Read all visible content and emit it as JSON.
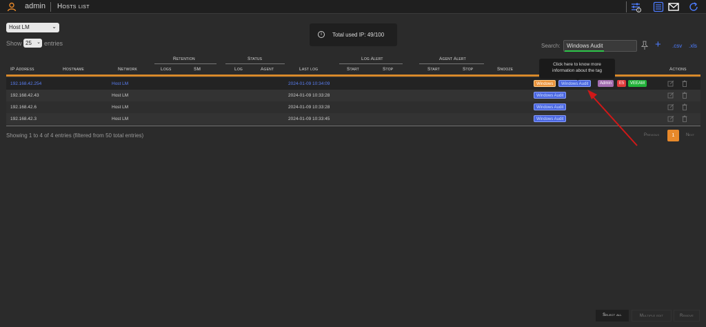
{
  "topbar": {
    "user_name": "admin",
    "page_title": "Hosts list"
  },
  "controls": {
    "network_select": "Host LM",
    "show_label": "Show",
    "entries_value": "25",
    "entries_label": "entries"
  },
  "toast": {
    "text": "Total used IP: 49/100"
  },
  "search": {
    "label": "Search:",
    "value": "Windows Audit",
    "csv_label": ".csv",
    "xls_label": ".xls"
  },
  "table": {
    "group_headers": {
      "retention": "Retention",
      "status": "Status",
      "log_alert": "Log Alert",
      "agent_alert": "Agent Alert"
    },
    "columns": {
      "ip": "IP Address",
      "hostname": "Hostname",
      "network": "Network",
      "logs": "Logs",
      "sm": "SM",
      "log": "Log",
      "agent": "Agent",
      "last_log": "Last log",
      "la_start": "Start",
      "la_stop": "Stop",
      "aa_start": "Start",
      "aa_stop": "Stop",
      "snooze": "Snooze",
      "actions": "Actions"
    },
    "rows": [
      {
        "ip": "192.168.42.254",
        "network": "Host LM",
        "last_log": "2024-01-09 10:34:09",
        "tags": [
          "Windows",
          "Windows Audit",
          "Admin",
          "E5",
          "VEEAM"
        ]
      },
      {
        "ip": "192.168.42.43",
        "network": "Host LM",
        "last_log": "2024-01-09 10:33:28",
        "tags": [
          "Windows Audit"
        ]
      },
      {
        "ip": "192.168.42.6",
        "network": "Host LM",
        "last_log": "2024-01-09 10:33:28",
        "tags": [
          "Windows Audit"
        ]
      },
      {
        "ip": "192.168.42.3",
        "network": "Host LM",
        "last_log": "2024-01-09 10:33:45",
        "tags": [
          "Windows Audit"
        ]
      }
    ]
  },
  "tooltip": {
    "text": "Click here to know more information about the tag"
  },
  "footer": {
    "info": "Showing 1 to 4 of 4 entries (filtered from 50 total entries)",
    "previous": "Previous",
    "page": "1",
    "next": "Next"
  },
  "bottom_actions": {
    "select_all": "Select all",
    "multiple_edit": "Multiple edit",
    "remove": "Remove"
  },
  "colors": {
    "accent_orange": "#d98a2a",
    "link_blue": "#4d7cff",
    "annotation_arrow": "#d01818"
  },
  "icons": [
    "user-icon",
    "filter-settings-icon",
    "list-icon",
    "mail-icon",
    "refresh-icon",
    "pin-icon",
    "plus-icon",
    "edit-icon",
    "trash-icon",
    "info-icon"
  ]
}
